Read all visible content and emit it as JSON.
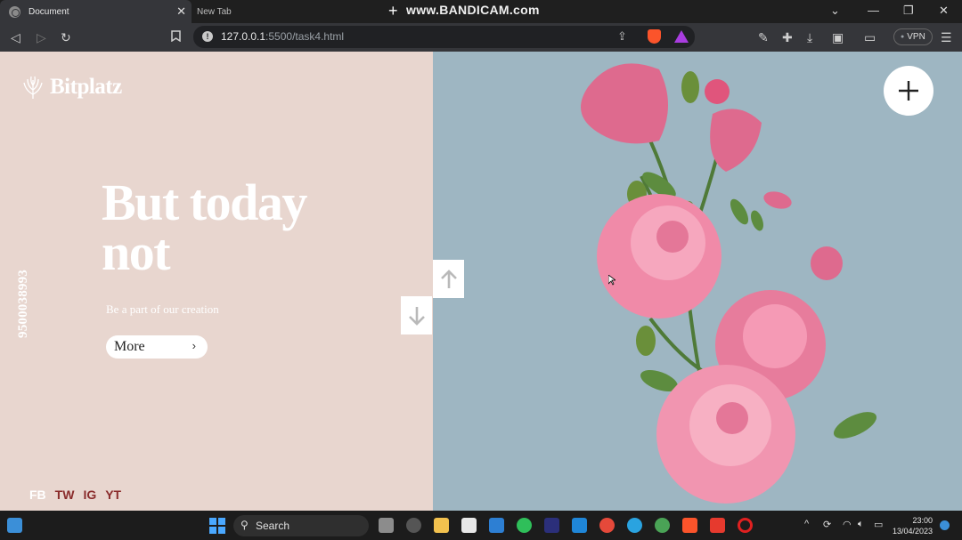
{
  "browser": {
    "tabs": [
      {
        "label": "Document",
        "active": true
      },
      {
        "label": "New Tab",
        "active": false
      }
    ],
    "watermark": "www.BANDICAM.com",
    "url_host": "127.0.0.1",
    "url_path": ":5500/task4.html",
    "vpn_label": "VPN"
  },
  "site": {
    "logo": "Bitplatz",
    "hero_title": "But today not",
    "hero_subtitle": "Be a part of our creation",
    "more_label": "More",
    "phone": "9500038993",
    "socials": [
      "FB",
      "TW",
      "IG",
      "YT"
    ],
    "colors": {
      "left_bg": "#e8d6cf",
      "right_bg": "#9eb6c2",
      "accent": "#8a2c2c"
    }
  },
  "taskbar": {
    "search_label": "Search",
    "time": "23:00",
    "date": "13/04/2023"
  }
}
